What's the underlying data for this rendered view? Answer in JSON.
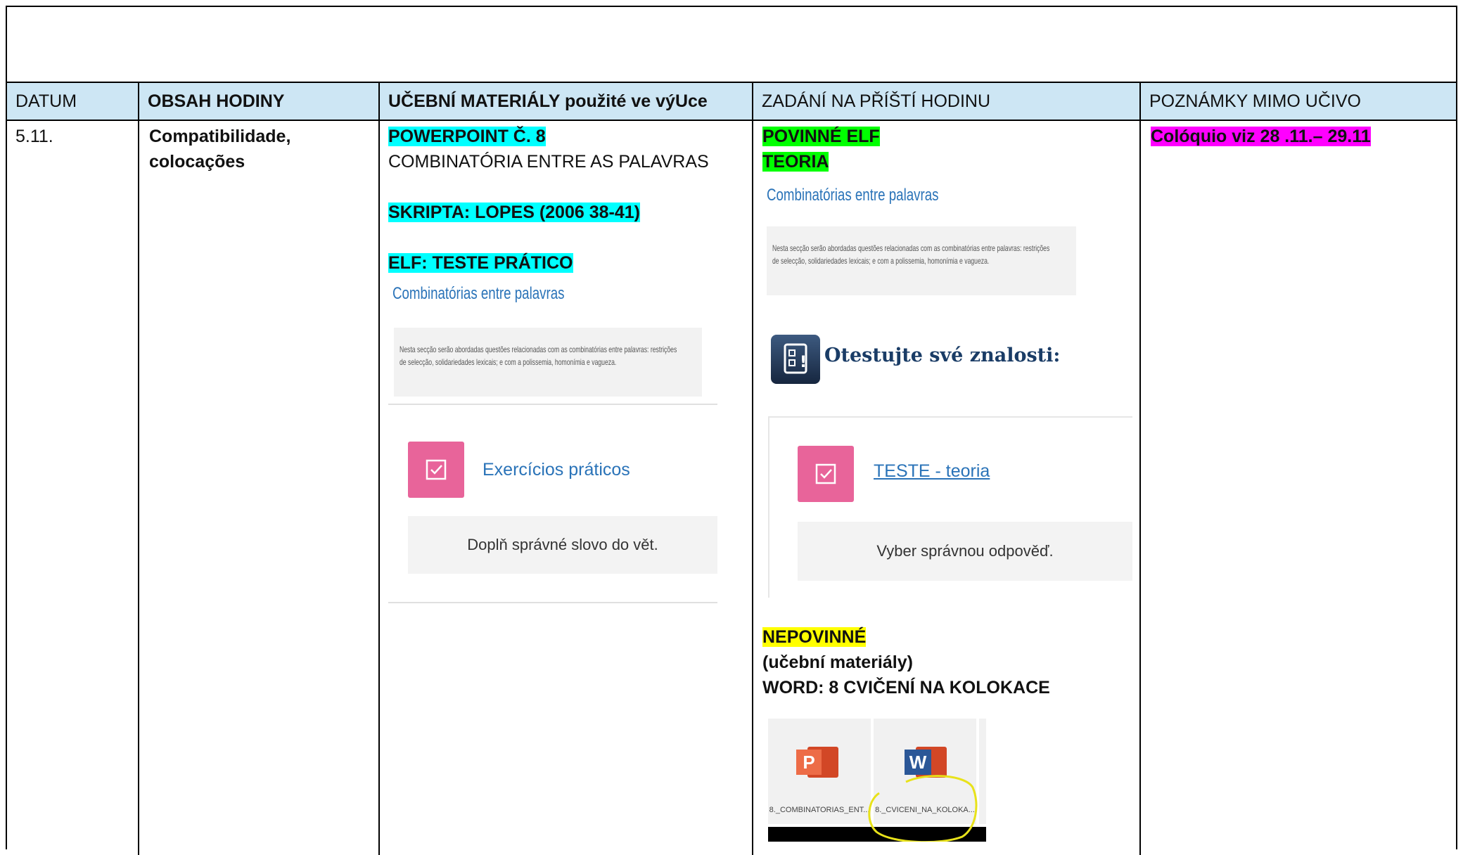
{
  "headers": {
    "datum": "DATUM",
    "obsah": "OBSAH HODINY",
    "materialy_bold": "UČEBNÍ MATERIÁLY",
    "materialy_rest": " použité ve výUce",
    "zadani": "ZADÁNÍ NA PŘÍŠTÍ HODINU",
    "poznamky": "POZNÁMKY MIMO UČIVO"
  },
  "row": {
    "datum": "5.11.",
    "obsah": [
      "Compatibilidade,",
      "colocações"
    ],
    "materialy": {
      "powerpoint": "POWERPOINT Č. 8",
      "combinatoria": "COMBINATÓRIA ENTRE AS PALAVRAS",
      "skripta": "SKRIPTA: LOPES (2006 38-41)",
      "elf": "ELF: TESTE PRÁTICO",
      "section_title": "Combinatórias entre palavras",
      "section_desc": "Nesta secção serão abordadas questões relacionadas com as combinatórias entre palavras: restrições de selecção, solidariedades lexicais; e com a polissemia, homonímia e vagueza.",
      "activity_title": "Exercícios práticos",
      "activity_desc": "Doplň správné slovo do vět."
    },
    "zadani": {
      "povinne": "POVINNÉ ELF",
      "teoria": "TEORIA",
      "section_title": "Combinatórias entre palavras",
      "section_desc": "Nesta secção serão abordadas questões relacionadas com as combinatórias entre palavras: restrições de selecção, solidariedades lexicais; e com a polissemia, homonímia e vagueza.",
      "test_heading": "Otestujte své znalosti:",
      "test_link": "TESTE - teoria",
      "test_desc": "Vyber správnou odpověď.",
      "nepovinne": "NEPOVINNÉ",
      "ucebni": "(učební materiály)",
      "word": "WORD: 8 CVIČENÍ NA KOLOKACE",
      "file1": "8._COMBINATORIAS_ENT...",
      "file2": "8._CVICENI_NA_KOLOKA..."
    },
    "poznamky": "Colóquio viz 28 .11.– 29.11"
  },
  "colors": {
    "header_bg": "#cde6f4",
    "cyan": "#00ffff",
    "green": "#00ff00",
    "yellow": "#ffff00",
    "magenta": "#ff00ff",
    "activity_pink": "#e8649a",
    "link_blue": "#2a73b8"
  },
  "icons": [
    "checkbox-icon",
    "quiz-icon",
    "powerpoint-icon",
    "word-icon"
  ]
}
